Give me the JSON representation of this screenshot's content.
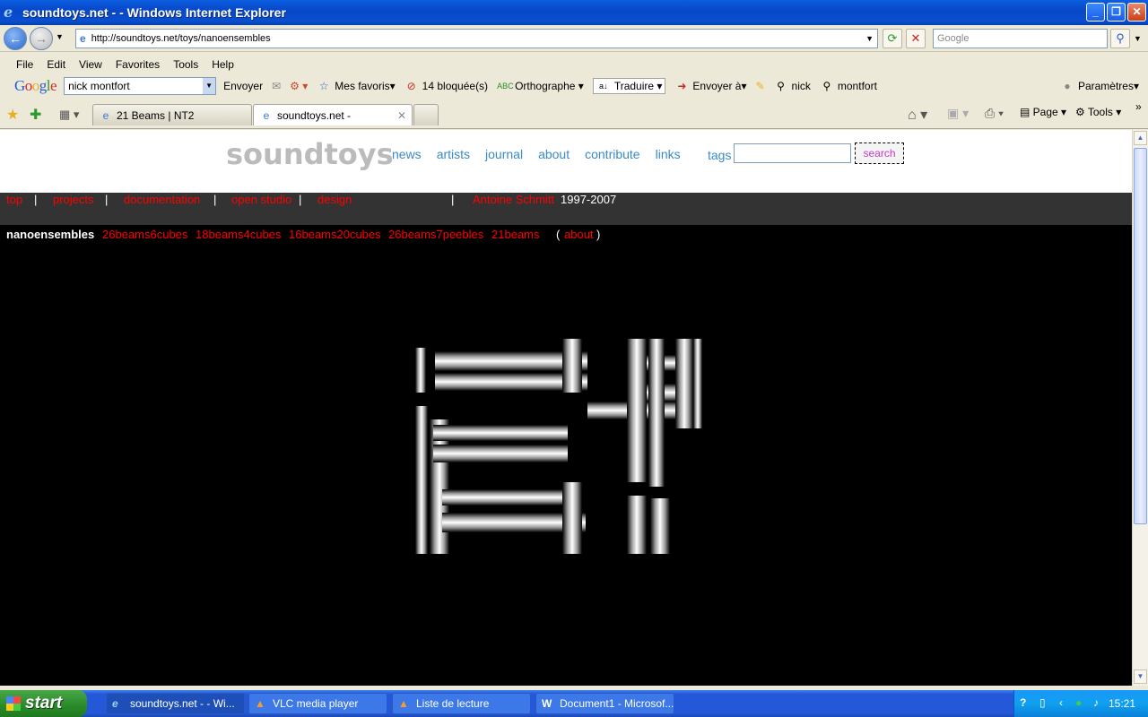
{
  "window": {
    "title": "soundtoys.net - - Windows Internet Explorer"
  },
  "address": {
    "url": "http://soundtoys.net/toys/nanoensembles",
    "search_placeholder": "Google"
  },
  "menu": [
    "File",
    "Edit",
    "View",
    "Favorites",
    "Tools",
    "Help"
  ],
  "google_toolbar": {
    "logo": "Google",
    "query": "nick montfort",
    "send": "Envoyer",
    "favorites": "Mes favoris",
    "blocked": "14 bloquée(s)",
    "spelling": "Orthographe",
    "translate": "Traduire",
    "send_to": "Envoyer à",
    "term1": "nick",
    "term2": "montfort",
    "settings": "Paramètres"
  },
  "tabs": [
    {
      "label": "21 Beams | NT2"
    },
    {
      "label": "soundtoys.net -"
    }
  ],
  "command_bar": {
    "page": "Page",
    "tools": "Tools"
  },
  "site": {
    "logo": "soundtoys",
    "nav": [
      "news",
      "artists",
      "journal",
      "about",
      "contribute",
      "links"
    ],
    "tags_label": "tags",
    "search_button": "search",
    "red_nav": [
      "top",
      "projects",
      "documentation",
      "open studio",
      "design"
    ],
    "separator": "|",
    "artist": "Antoine Schmitt",
    "years": "1997-2007",
    "current": "nanoensembles",
    "sub_nav": [
      "26beams6cubes",
      "18beams4cubes",
      "16beams20cubes",
      "26beams7peebles",
      "21beams"
    ],
    "about": "about",
    "paren_open": "(",
    "paren_close": ")"
  },
  "taskbar": {
    "start": "start",
    "tasks": [
      {
        "label": "soundtoys.net - - Wi..."
      },
      {
        "label": "VLC media player"
      },
      {
        "label": "Liste de lecture"
      },
      {
        "label": "Document1 - Microsof..."
      }
    ],
    "clock": "15:21"
  }
}
